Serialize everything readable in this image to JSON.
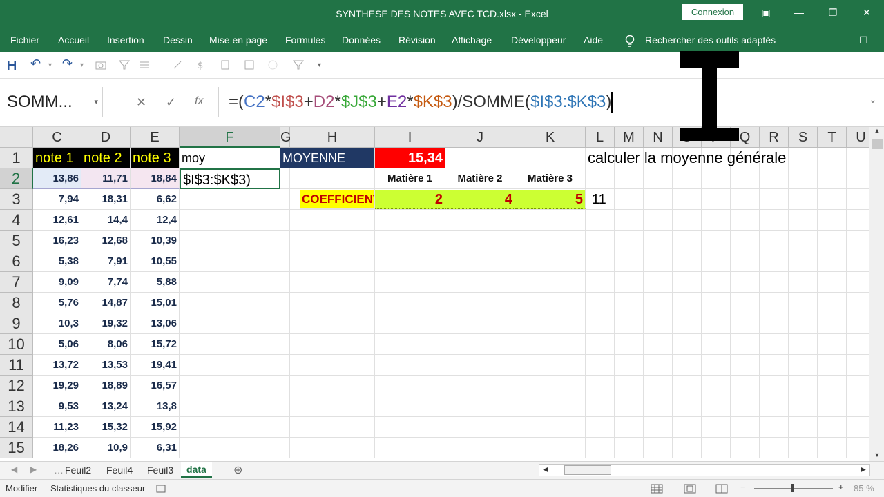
{
  "window": {
    "title": "SYNTHESE DES NOTES AVEC TCD.xlsx  -  Excel",
    "connexion": "Connexion",
    "restore_icon": "▣",
    "minimize_icon": "—",
    "maximize_icon": "❐",
    "close_icon": "✕"
  },
  "ribbon": {
    "tabs": [
      "Fichier",
      "Accueil",
      "Insertion",
      "Dessin",
      "Mise en page",
      "Formules",
      "Données",
      "Révision",
      "Affichage",
      "Développeur",
      "Aide"
    ],
    "search": "Rechercher des outils adaptés",
    "comment_icon": "☐"
  },
  "qat": {
    "save_icon": "💾",
    "undo_icon": "↶",
    "redo_icon": "↷",
    "undo_dd": "▾",
    "redo_dd": "▾",
    "more": "▾"
  },
  "formula_bar": {
    "name_box": "SOMM...",
    "name_dd": "▾",
    "cancel": "✕",
    "enter": "✓",
    "fx": "fx",
    "formula_parts": [
      {
        "t": "=(",
        "c": "#333333"
      },
      {
        "t": "C2",
        "c": "#4472c4"
      },
      {
        "t": "*",
        "c": "#333333"
      },
      {
        "t": "$I$3",
        "c": "#c0504d"
      },
      {
        "t": "+",
        "c": "#333333"
      },
      {
        "t": "D2",
        "c": "#a64d79"
      },
      {
        "t": "*",
        "c": "#333333"
      },
      {
        "t": "$J$3",
        "c": "#38a838"
      },
      {
        "t": "+",
        "c": "#333333"
      },
      {
        "t": "E2",
        "c": "#7030a0"
      },
      {
        "t": "*",
        "c": "#333333"
      },
      {
        "t": "$K$3",
        "c": "#c55a11"
      },
      {
        "t": ")/SOMME(",
        "c": "#333333"
      },
      {
        "t": "$I$3:$K$3",
        "c": "#2e75b6"
      },
      {
        "t": ")",
        "c": "#333333"
      }
    ],
    "expand": "⌄"
  },
  "columns": [
    "C",
    "D",
    "E",
    "F",
    "G",
    "H",
    "I",
    "J",
    "K",
    "L",
    "M",
    "N",
    "O",
    "P",
    "Q",
    "R",
    "S",
    "T",
    "U"
  ],
  "rows": [
    "1",
    "2",
    "3",
    "4",
    "5",
    "6",
    "7",
    "8",
    "9",
    "10",
    "11",
    "12",
    "13",
    "14",
    "15"
  ],
  "sheet": {
    "headers": {
      "c": "note 1",
      "d": "note 2",
      "e": "note 3",
      "f": "moy"
    },
    "editing_cell": "$I$3:$K$3)",
    "notes": [
      [
        "13,86",
        "11,71",
        "18,84"
      ],
      [
        "7,94",
        "18,31",
        "6,62"
      ],
      [
        "12,61",
        "14,4",
        "12,4"
      ],
      [
        "16,23",
        "12,68",
        "10,39"
      ],
      [
        "5,38",
        "7,91",
        "10,55"
      ],
      [
        "9,09",
        "7,74",
        "5,88"
      ],
      [
        "5,76",
        "14,87",
        "15,01"
      ],
      [
        "10,3",
        "19,32",
        "13,06"
      ],
      [
        "5,06",
        "8,06",
        "15,72"
      ],
      [
        "13,72",
        "13,53",
        "19,41"
      ],
      [
        "19,29",
        "18,89",
        "16,57"
      ],
      [
        "9,53",
        "13,24",
        "13,8"
      ],
      [
        "11,23",
        "15,32",
        "15,92"
      ],
      [
        "18,26",
        "10,9",
        "6,31"
      ]
    ],
    "moyenne_label": "MOYENNE",
    "moyenne_value": "15,34",
    "matieres": [
      "Matière 1",
      "Matière 2",
      "Matière 3"
    ],
    "coef_label": "COEFFICIENT",
    "coefs": [
      "2",
      "4",
      "5"
    ],
    "coef_sum": "11",
    "instruction": "calculer la moyenne générale"
  },
  "sheet_tabs": {
    "tabs": [
      "Feuil2",
      "Feuil4",
      "Feuil3"
    ],
    "active": "data",
    "add": "⊕"
  },
  "status": {
    "mode": "Modifier",
    "stats": "Statistiques du classeur",
    "zoom": "85 %"
  }
}
